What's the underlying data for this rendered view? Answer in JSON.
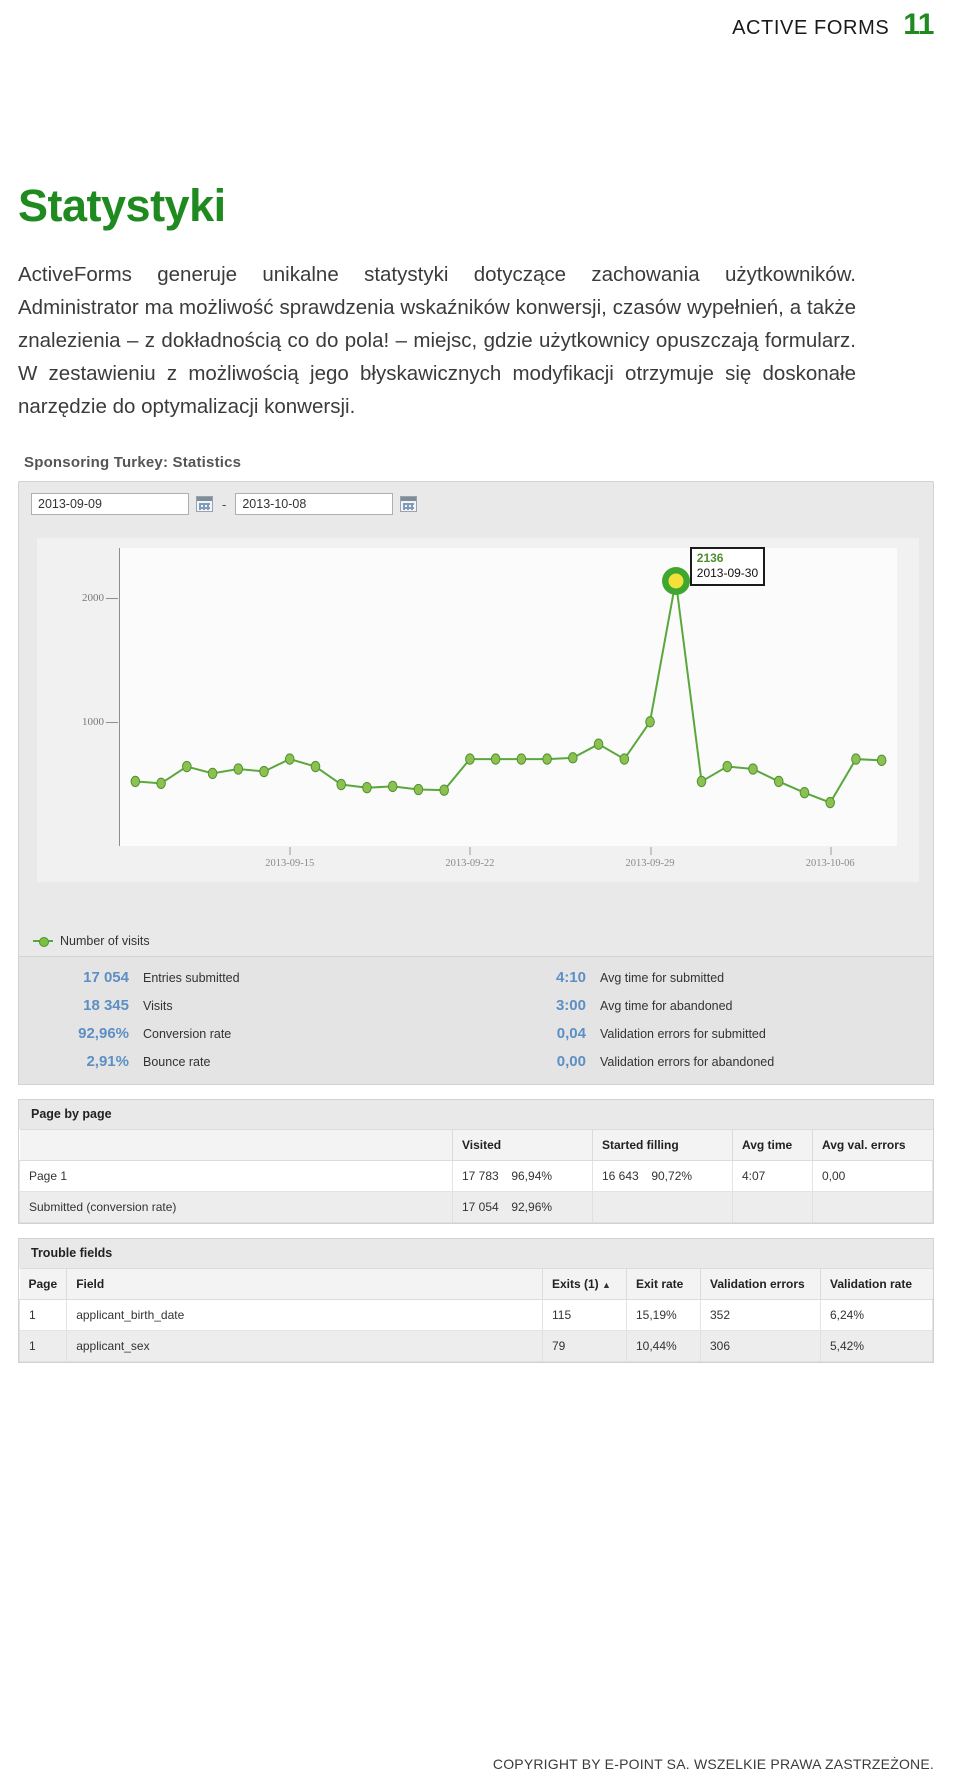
{
  "runhead": {
    "title": "ACTIVE FORMS",
    "page_number": "11"
  },
  "heading": "Statystyki",
  "body": {
    "p1": "ActiveForms generuje unikalne statystyki dotyczące zachowania użytkowników. Administrator ma możliwość sprawdzenia wskaźników konwersji, czasów wypełnień, a także znalezienia – z dokładnością co do pola! – miejsc, gdzie użytkownicy opuszczają formularz. W zestawieniu z możliwością jego błyskawicznych modyfikacji otrzymuje się doskonałe narzędzie do optymalizacji konwersji."
  },
  "screenshot": {
    "title": "Sponsoring Turkey: Statistics",
    "date_range": {
      "from_value": "2013-09-09",
      "to_value": "2013-10-08",
      "separator": "-",
      "from_icon": "calendar-icon",
      "to_icon": "calendar-icon"
    },
    "legend_label": "Number of visits",
    "tooltip": {
      "value": "2136",
      "date": "2013-09-30"
    },
    "stats": {
      "left": [
        {
          "value": "17 054",
          "label": "Entries submitted"
        },
        {
          "value": "18 345",
          "label": "Visits"
        },
        {
          "value": "92,96%",
          "label": "Conversion rate"
        },
        {
          "value": "2,91%",
          "label": "Bounce rate"
        }
      ],
      "right": [
        {
          "value": "4:10",
          "label": "Avg time for submitted"
        },
        {
          "value": "3:00",
          "label": "Avg time for abandoned"
        },
        {
          "value": "0,04",
          "label": "Validation errors for submitted"
        },
        {
          "value": "0,00",
          "label": "Validation errors for abandoned"
        }
      ]
    },
    "page_by_page": {
      "title": "Page by page",
      "columns": [
        "",
        "Visited",
        "Started filling",
        "Avg time",
        "Avg val. errors"
      ],
      "rows": [
        {
          "name": "Page 1",
          "visited_n": "17 783",
          "visited_p": "96,94%",
          "started_n": "16 643",
          "started_p": "90,72%",
          "avg_time": "4:07",
          "avg_val_errors": "0,00"
        },
        {
          "name": "Submitted (conversion rate)",
          "visited_n": "17 054",
          "visited_p": "92,96%",
          "started_n": "",
          "started_p": "",
          "avg_time": "",
          "avg_val_errors": ""
        }
      ]
    },
    "trouble_fields": {
      "title": "Trouble fields",
      "columns": [
        "Page",
        "Field",
        "Exits (1)",
        "Exit rate",
        "Validation errors",
        "Validation rate"
      ],
      "sort_indicator": "▲",
      "rows": [
        {
          "page": "1",
          "field": "applicant_birth_date",
          "exits": "115",
          "exit_rate": "15,19%",
          "validation_errors": "352",
          "validation_rate": "6,24%"
        },
        {
          "page": "1",
          "field": "applicant_sex",
          "exits": "79",
          "exit_rate": "10,44%",
          "validation_errors": "306",
          "validation_rate": "5,42%"
        }
      ]
    }
  },
  "footer": "COPYRIGHT BY E-POINT SA. WSZELKIE PRAWA ZASTRZEŻONE.",
  "colors": {
    "brand_green": "#1f8a1f",
    "series_green": "#5aa83c",
    "stat_blue": "#5d8fc4"
  },
  "chart_data": {
    "type": "line",
    "title": "",
    "xlabel": "",
    "ylabel": "",
    "series_name": "Number of visits",
    "ylim": [
      0,
      2400
    ],
    "yticks": [
      1000,
      2000
    ],
    "xticks": [
      "2013-09-15",
      "2013-09-22",
      "2013-09-29",
      "2013-10-06"
    ],
    "grid": false,
    "legend_position": "bottom-left",
    "x": [
      "2013-09-09",
      "2013-09-10",
      "2013-09-11",
      "2013-09-12",
      "2013-09-13",
      "2013-09-14",
      "2013-09-15",
      "2013-09-16",
      "2013-09-17",
      "2013-09-18",
      "2013-09-19",
      "2013-09-20",
      "2013-09-21",
      "2013-09-22",
      "2013-09-23",
      "2013-09-24",
      "2013-09-25",
      "2013-09-26",
      "2013-09-27",
      "2013-09-28",
      "2013-09-29",
      "2013-09-30",
      "2013-10-01",
      "2013-10-02",
      "2013-10-03",
      "2013-10-04",
      "2013-10-05",
      "2013-10-06",
      "2013-10-07",
      "2013-10-08"
    ],
    "values": [
      520,
      505,
      640,
      585,
      620,
      600,
      700,
      640,
      495,
      470,
      480,
      455,
      450,
      700,
      700,
      700,
      700,
      710,
      820,
      700,
      1000,
      2136,
      520,
      640,
      620,
      520,
      430,
      350,
      700,
      690
    ],
    "highlight": {
      "x": "2013-09-30",
      "y": 2136
    }
  }
}
